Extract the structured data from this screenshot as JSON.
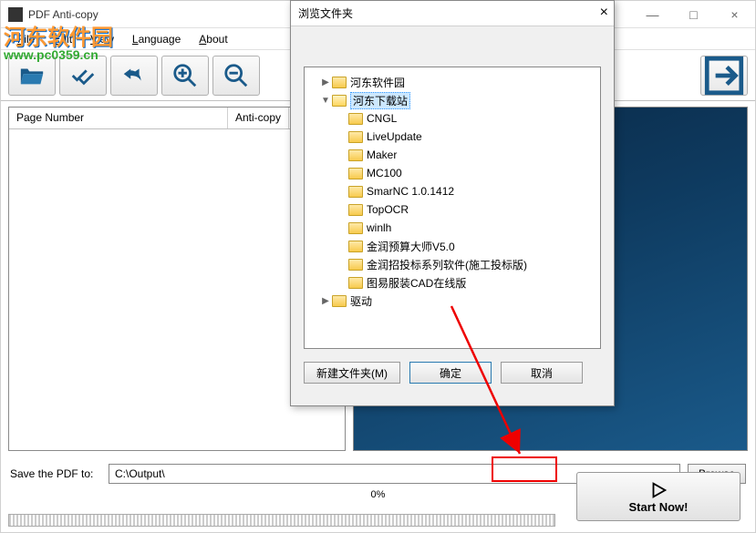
{
  "window": {
    "title": "PDF Anti-copy",
    "minimize": "—",
    "maximize": "□",
    "close": "×"
  },
  "watermark": {
    "line1": "河东软件园",
    "line2": "www.pc0359.cn"
  },
  "menu": {
    "file": "File",
    "edit": "Edit",
    "view": "View",
    "language": "Language",
    "about": "About"
  },
  "columns": {
    "page_number": "Page Number",
    "anti_copy": "Anti-copy"
  },
  "save": {
    "label": "Save the PDF to:",
    "path": "C:\\Output\\",
    "browse": "Browse"
  },
  "progress": {
    "text": "0%"
  },
  "start": {
    "label": "Start Now!"
  },
  "dialog": {
    "title": "浏览文件夹",
    "close": "×",
    "tree": [
      {
        "label": "河东软件园",
        "indent": 1,
        "arrow": "▶",
        "sel": false
      },
      {
        "label": "河东下载站",
        "indent": 1,
        "arrow": "▼",
        "sel": true
      },
      {
        "label": "CNGL",
        "indent": 2,
        "arrow": "",
        "sel": false
      },
      {
        "label": "LiveUpdate",
        "indent": 2,
        "arrow": "",
        "sel": false
      },
      {
        "label": "Maker",
        "indent": 2,
        "arrow": "",
        "sel": false
      },
      {
        "label": "MC100",
        "indent": 2,
        "arrow": "",
        "sel": false
      },
      {
        "label": "SmarNC 1.0.1412",
        "indent": 2,
        "arrow": "",
        "sel": false
      },
      {
        "label": "TopOCR",
        "indent": 2,
        "arrow": "",
        "sel": false
      },
      {
        "label": "winlh",
        "indent": 2,
        "arrow": "",
        "sel": false
      },
      {
        "label": "金润预算大师V5.0",
        "indent": 2,
        "arrow": "",
        "sel": false
      },
      {
        "label": "金润招投标系列软件(施工投标版)",
        "indent": 2,
        "arrow": "",
        "sel": false
      },
      {
        "label": "图易服装CAD在线版",
        "indent": 2,
        "arrow": "",
        "sel": false
      },
      {
        "label": "驱动",
        "indent": 1,
        "arrow": "▶",
        "sel": false
      }
    ],
    "new_folder": "新建文件夹(M)",
    "ok": "确定",
    "cancel": "取消"
  },
  "icons": {
    "open": "open-folder-icon",
    "check": "check-all-icon",
    "undo": "undo-icon",
    "zoom_in": "zoom-in-icon",
    "zoom_out": "zoom-out-icon",
    "exit": "exit-icon",
    "play": "play-icon"
  }
}
